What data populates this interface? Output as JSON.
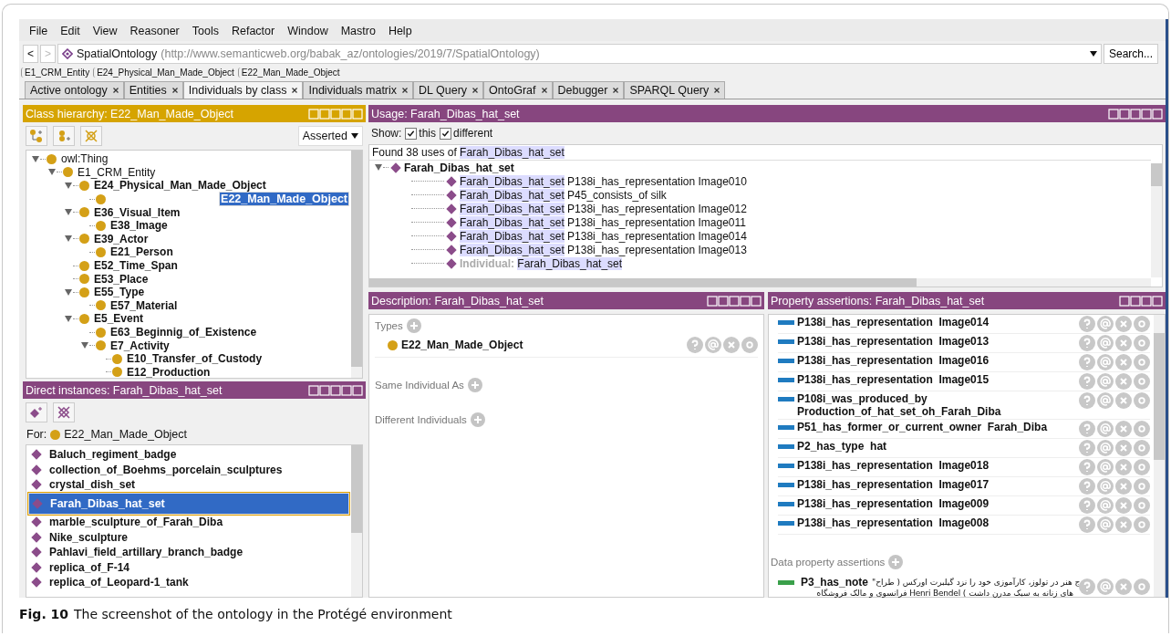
{
  "menu": [
    "File",
    "Edit",
    "View",
    "Reasoner",
    "Tools",
    "Refactor",
    "Window",
    "Mastro",
    "Help"
  ],
  "address": {
    "back": {
      "label": "<",
      "disabled": false
    },
    "forward": {
      "label": ">",
      "disabled": true
    },
    "ontology": "SpatialOntology",
    "iri": "(http://www.semanticweb.org/babak_az/ontologies/2019/7/SpatialOntology)",
    "search_button": "Search..."
  },
  "breadcrumb": [
    "E1_CRM_Entity",
    "E24_Physical_Man_Made_Object",
    "E22_Man_Made_Object"
  ],
  "tabs": [
    {
      "label": "Active ontology",
      "selected": false
    },
    {
      "label": "Entities",
      "selected": false
    },
    {
      "label": "Individuals by class",
      "selected": true
    },
    {
      "label": "Individuals matrix",
      "selected": false
    },
    {
      "label": "DL Query",
      "selected": false
    },
    {
      "label": "OntoGraf",
      "selected": false
    },
    {
      "label": "Debugger",
      "selected": false
    },
    {
      "label": "SPARQL Query",
      "selected": false
    }
  ],
  "class_hierarchy": {
    "title": "Class hierarchy: E22_Man_Made_Object",
    "has_help": true,
    "mode": "Asserted",
    "tree": [
      {
        "label": "owl:Thing",
        "bold": false,
        "selected": false,
        "children": [
          {
            "label": "E1_CRM_Entity",
            "bold": false,
            "selected": false,
            "children": [
              {
                "label": "E24_Physical_Man_Made_Object",
                "bold": true,
                "selected": false,
                "children": [
                  {
                    "label": "E22_Man_Made_Object",
                    "bold": true,
                    "selected": true
                  }
                ]
              },
              {
                "label": "E36_Visual_Item",
                "bold": true,
                "selected": false,
                "children": [
                  {
                    "label": "E38_Image",
                    "bold": true,
                    "selected": false
                  }
                ]
              },
              {
                "label": "E39_Actor",
                "bold": true,
                "selected": false,
                "children": [
                  {
                    "label": "E21_Person",
                    "bold": true,
                    "selected": false
                  }
                ]
              },
              {
                "label": "E52_Time_Span",
                "bold": true,
                "selected": false
              },
              {
                "label": "E53_Place",
                "bold": true,
                "selected": false
              },
              {
                "label": "E55_Type",
                "bold": true,
                "selected": false,
                "children": [
                  {
                    "label": "E57_Material",
                    "bold": true,
                    "selected": false
                  }
                ]
              },
              {
                "label": "E5_Event",
                "bold": true,
                "selected": false,
                "children": [
                  {
                    "label": "E63_Beginnig_of_Existence",
                    "bold": true,
                    "selected": false
                  },
                  {
                    "label": "E7_Activity",
                    "bold": true,
                    "selected": false,
                    "children": [
                      {
                        "label": "E10_Transfer_of_Custody",
                        "bold": true,
                        "selected": false
                      },
                      {
                        "label": "E12_Production",
                        "bold": true,
                        "selected": false
                      }
                    ]
                  }
                ]
              }
            ]
          }
        ]
      }
    ]
  },
  "direct_instances": {
    "title": "Direct instances: Farah_Dibas_hat_set",
    "has_help": true,
    "for_label": "For:",
    "for_class": "E22_Man_Made_Object",
    "items": [
      {
        "label": "Baluch_regiment_badge",
        "selected": false
      },
      {
        "label": "collection_of_Boehms_porcelain_sculptures",
        "selected": false
      },
      {
        "label": "crystal_dish_set",
        "selected": false
      },
      {
        "label": "Farah_Dibas_hat_set",
        "selected": true
      },
      {
        "label": "marble_sculpture_of_Farah_Diba",
        "selected": false
      },
      {
        "label": "Nike_sculpture",
        "selected": false
      },
      {
        "label": "Pahlavi_field_artillary_branch_badge",
        "selected": false
      },
      {
        "label": "replica_of_F-14",
        "selected": false
      },
      {
        "label": "replica_of_Leopard-1_tank",
        "selected": false
      }
    ]
  },
  "usage": {
    "title": "Usage: Farah_Dibas_hat_set",
    "has_help": true,
    "show_label": "Show:",
    "options": [
      {
        "label": "this",
        "checked": true
      },
      {
        "label": "different",
        "checked": true
      }
    ],
    "found_prefix": "Found 38 uses of",
    "found_subject": "Farah_Dibas_hat_set",
    "root": "Farah_Dibas_hat_set",
    "rows": [
      {
        "subject": "Farah_Dibas_hat_set",
        "rest": "P138i_has_representation Image010"
      },
      {
        "subject": "Farah_Dibas_hat_set",
        "rest": "P45_consists_of silk"
      },
      {
        "subject": "Farah_Dibas_hat_set",
        "rest": "P138i_has_representation Image012"
      },
      {
        "subject": "Farah_Dibas_hat_set",
        "rest": "P138i_has_representation Image011"
      },
      {
        "subject": "Farah_Dibas_hat_set",
        "rest": "P138i_has_representation Image014"
      },
      {
        "subject": "Farah_Dibas_hat_set",
        "rest": "P138i_has_representation Image013"
      }
    ],
    "last_row": {
      "kind": "Individual:",
      "value": "Farah_Dibas_hat_set"
    }
  },
  "description": {
    "title": "Description: Farah_Dibas_hat_set",
    "has_help": true,
    "sections": [
      {
        "label": "Types",
        "items": [
          "E22_Man_Made_Object"
        ]
      },
      {
        "label": "Same Individual As"
      },
      {
        "label": "Different Individuals"
      }
    ]
  },
  "property_assertions": {
    "title": "Property assertions: Farah_Dibas_hat_set",
    "has_help": false,
    "object_rows": [
      {
        "property": "P138i_has_representation",
        "value": "Image014"
      },
      {
        "property": "P138i_has_representation",
        "value": "Image013"
      },
      {
        "property": "P138i_has_representation",
        "value": "Image016"
      },
      {
        "property": "P138i_has_representation",
        "value": "Image015"
      },
      {
        "property": "P108i_was_produced_by",
        "value": "Production_of_hat_set_oh_Farah_Diba"
      },
      {
        "property": "P51_has_former_or_current_owner",
        "value": "Farah_Diba"
      },
      {
        "property": "P2_has_type",
        "value": "hat"
      },
      {
        "property": "P138i_has_representation",
        "value": "Image018"
      },
      {
        "property": "P138i_has_representation",
        "value": "Image017"
      },
      {
        "property": "P138i_has_representation",
        "value": "Image009"
      },
      {
        "property": "P138i_has_representation",
        "value": "Image008"
      }
    ],
    "data_label": "Data property assertions",
    "data_rows": [
      {
        "property": "P3_has_note",
        "value_lines": [
          "ج هنر در تولوز، کارآموزی خود را نزد گیلبرت اورکس ( طراح\"",
          "های زنانه به سبک مدرن داشت ) Henri Bendel فرانسوی و مالک فروشگاه"
        ]
      }
    ]
  },
  "caption": {
    "label": "Fig. 10",
    "text": "The screenshot of the ontology in the Protégé environment"
  }
}
